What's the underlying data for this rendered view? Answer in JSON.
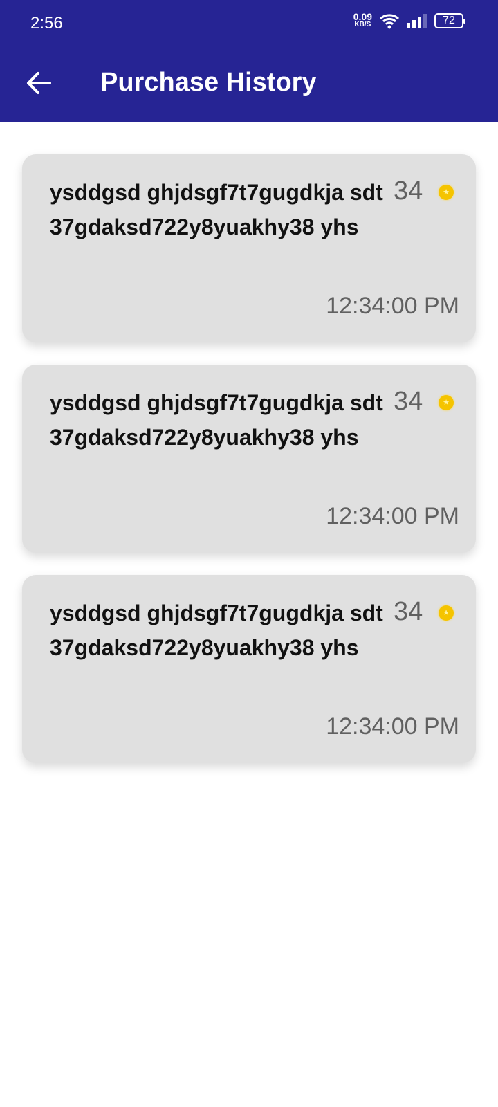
{
  "status_bar": {
    "time": "2:56",
    "speed_value": "0.09",
    "speed_unit": "KB/S",
    "battery": "72"
  },
  "header": {
    "title": "Purchase History",
    "back_icon": "arrow-left-icon"
  },
  "colors": {
    "header": "#262494",
    "card": "#e0e0e0",
    "coin": "#f5c400"
  },
  "purchases": [
    {
      "name": "ysddgsd ghjdsgf7t7gugdkja sdt37gdaksd722y8yuakhy38 yhs",
      "amount": "34",
      "time": "12:34:00 PM"
    },
    {
      "name": "ysddgsd ghjdsgf7t7gugdkja sdt37gdaksd722y8yuakhy38 yhs",
      "amount": "34",
      "time": "12:34:00 PM"
    },
    {
      "name": "ysddgsd ghjdsgf7t7gugdkja sdt37gdaksd722y8yuakhy38 yhs",
      "amount": "34",
      "time": "12:34:00 PM"
    }
  ]
}
